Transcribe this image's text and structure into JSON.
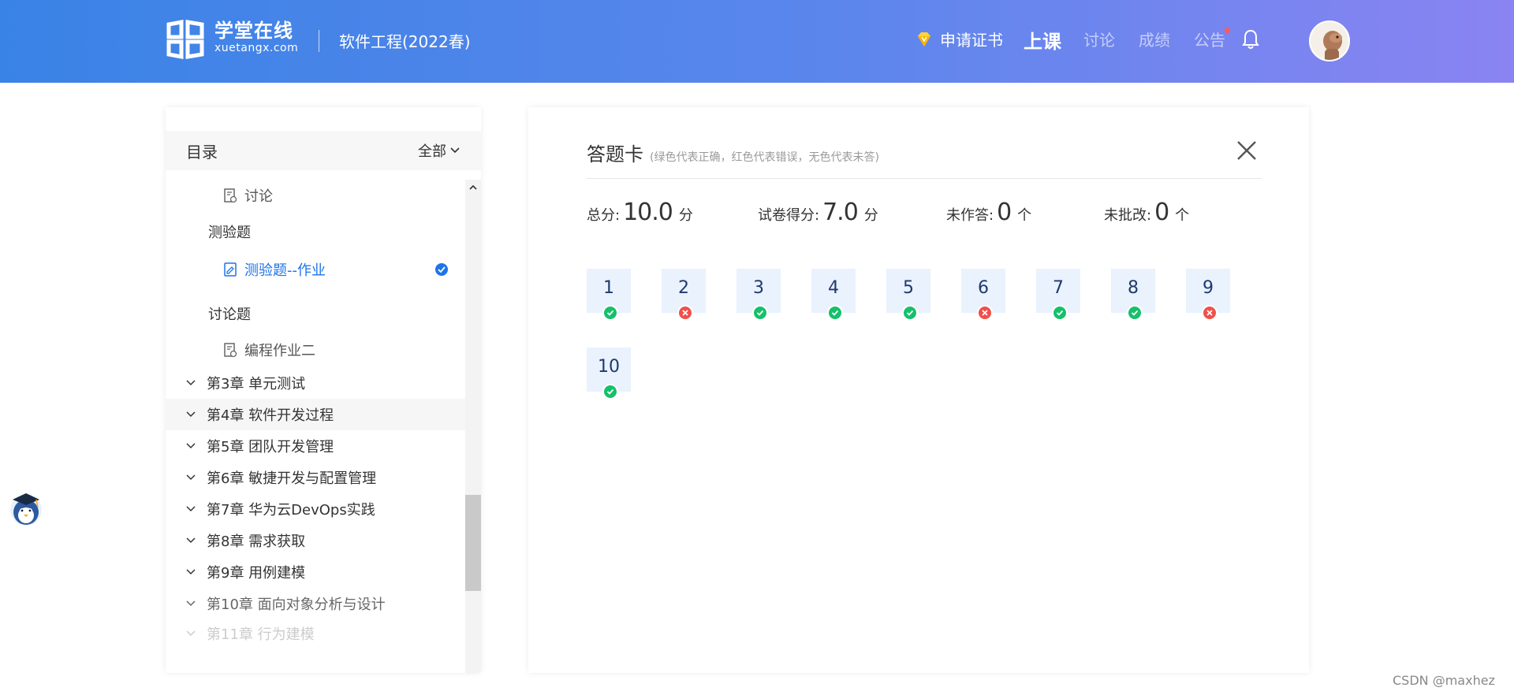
{
  "header": {
    "logo_cn": "学堂在线",
    "logo_en": "xuetangx.com",
    "course": "软件工程(2022春)",
    "nav": {
      "certificate": "申请证书",
      "lesson": "上课",
      "discussion": "讨论",
      "grades": "成绩",
      "notice": "公告"
    }
  },
  "sidebar": {
    "title": "目录",
    "filter": "全部",
    "items": [
      {
        "label": "讨论",
        "kind": "doc"
      },
      {
        "label": "测验题",
        "kind": "section"
      },
      {
        "label": "测验题--作业",
        "kind": "quiz",
        "active": true
      },
      {
        "label": "讨论题",
        "kind": "section"
      },
      {
        "label": "编程作业二",
        "kind": "doc"
      },
      {
        "label": "第3章 单元测试",
        "kind": "chapter"
      },
      {
        "label": "第4章 软件开发过程",
        "kind": "chapter"
      },
      {
        "label": "第5章 团队开发管理",
        "kind": "chapter"
      },
      {
        "label": "第6章 敏捷开发与配置管理",
        "kind": "chapter"
      },
      {
        "label": "第7章 华为云DevOps实践",
        "kind": "chapter"
      },
      {
        "label": "第8章 需求获取",
        "kind": "chapter"
      },
      {
        "label": "第9章 用例建模",
        "kind": "chapter"
      },
      {
        "label": "第10章 面向对象分析与设计",
        "kind": "chapter"
      },
      {
        "label": "第11章 行为建模",
        "kind": "chapter"
      }
    ]
  },
  "answer_card": {
    "title": "答题卡",
    "hint": "(绿色代表正确，红色代表错误，无色代表未答)",
    "stats": {
      "total_label": "总分:",
      "total_value": "10.0",
      "total_unit": "分",
      "score_label": "试卷得分:",
      "score_value": "7.0",
      "score_unit": "分",
      "unanswered_label": "未作答:",
      "unanswered_value": "0",
      "unanswered_unit": "个",
      "ungraded_label": "未批改:",
      "ungraded_value": "0",
      "ungraded_unit": "个"
    },
    "questions": [
      {
        "n": "1",
        "status": "correct"
      },
      {
        "n": "2",
        "status": "wrong"
      },
      {
        "n": "3",
        "status": "correct"
      },
      {
        "n": "4",
        "status": "correct"
      },
      {
        "n": "5",
        "status": "correct"
      },
      {
        "n": "6",
        "status": "wrong"
      },
      {
        "n": "7",
        "status": "correct"
      },
      {
        "n": "8",
        "status": "correct"
      },
      {
        "n": "9",
        "status": "wrong"
      },
      {
        "n": "10",
        "status": "correct"
      }
    ]
  },
  "colors": {
    "accent": "#1e74e8",
    "correct": "#16c06a",
    "wrong": "#f0504a"
  },
  "watermark": "CSDN @maxhez"
}
